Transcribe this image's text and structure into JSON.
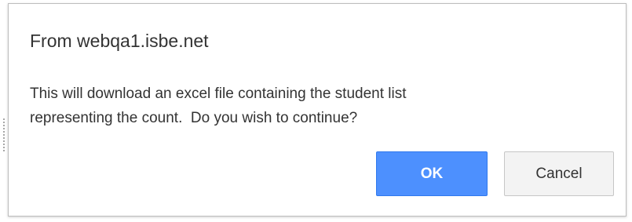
{
  "dialog": {
    "title": "From webqa1.isbe.net",
    "message_lines": [
      "This will download an excel file containing the student list",
      "representing the count.  Do you wish to continue?"
    ],
    "buttons": {
      "ok_label": "OK",
      "cancel_label": "Cancel"
    }
  },
  "colors": {
    "ok_button_bg": "#4d90fe",
    "ok_button_border": "#3079ed",
    "cancel_button_bg": "#f3f3f3",
    "text": "#333333"
  }
}
